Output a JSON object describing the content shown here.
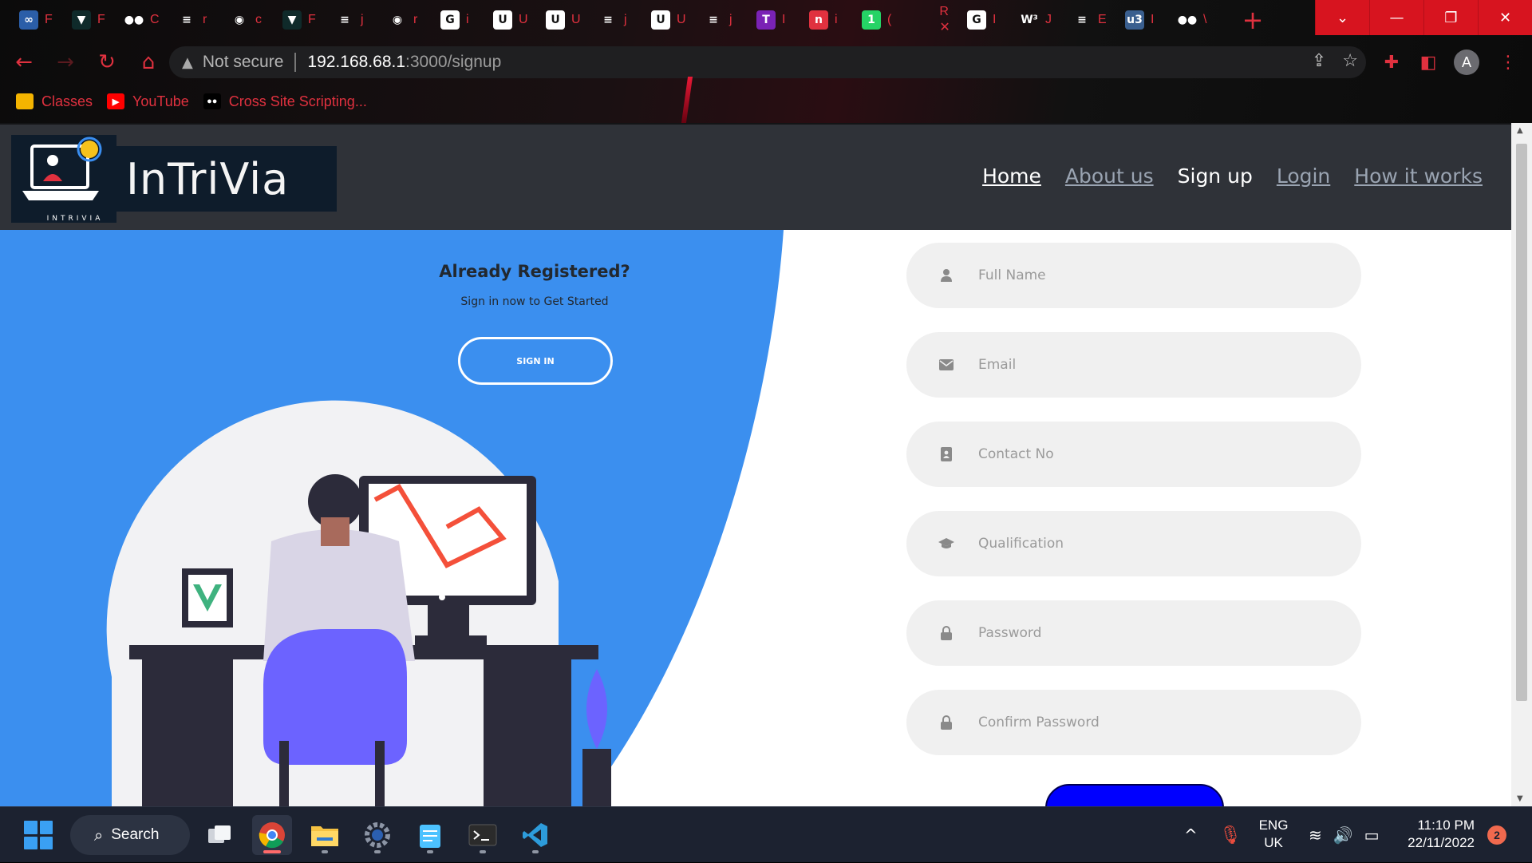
{
  "browser": {
    "tabs": [
      {
        "icon": "infinity-icon",
        "letter": "F",
        "bg": "#2b5ea8",
        "glyph": "∞"
      },
      {
        "icon": "hackthebox-icon",
        "letter": "F",
        "bg": "#0f2a2a",
        "glyph": "▼"
      },
      {
        "icon": "medium-icon",
        "letter": "C",
        "bg": "transparent",
        "glyph": "●●"
      },
      {
        "icon": "stackoverflow-icon",
        "letter": "r",
        "bg": "transparent",
        "glyph": "≡"
      },
      {
        "icon": "github-icon",
        "letter": "c",
        "bg": "transparent",
        "glyph": "◉"
      },
      {
        "icon": "hackthebox-icon",
        "letter": "F",
        "bg": "#0f2a2a",
        "glyph": "▼"
      },
      {
        "icon": "stackoverflow-icon",
        "letter": "j",
        "bg": "transparent",
        "glyph": "≡"
      },
      {
        "icon": "github-icon",
        "letter": "r",
        "bg": "transparent",
        "glyph": "◉"
      },
      {
        "icon": "google-icon",
        "letter": "i",
        "bg": "#ffffff",
        "glyph": "G"
      },
      {
        "icon": "udemy-icon",
        "letter": "U",
        "bg": "#ffffff",
        "glyph": "U"
      },
      {
        "icon": "udemy-icon",
        "letter": "U",
        "bg": "#ffffff",
        "glyph": "U"
      },
      {
        "icon": "stackoverflow-icon",
        "letter": "j",
        "bg": "transparent",
        "glyph": "≡"
      },
      {
        "icon": "udemy-icon",
        "letter": "U",
        "bg": "#ffffff",
        "glyph": "U"
      },
      {
        "icon": "stackoverflow-icon",
        "letter": "j",
        "bg": "transparent",
        "glyph": "≡"
      },
      {
        "icon": "tryhackme-icon",
        "letter": "I",
        "bg": "#7a22b5",
        "glyph": "T"
      },
      {
        "icon": "notion-icon",
        "letter": "i",
        "bg": "#e0313f",
        "glyph": "n"
      },
      {
        "icon": "whatsapp-icon",
        "letter": "(",
        "bg": "#25d366",
        "glyph": "1"
      },
      {
        "icon": "r-tab-icon",
        "letter": "R ✕",
        "bg": "transparent",
        "glyph": ""
      },
      {
        "icon": "google-icon",
        "letter": "I",
        "bg": "#ffffff",
        "glyph": "G"
      },
      {
        "icon": "w3schools-icon",
        "letter": "J",
        "bg": "transparent",
        "glyph": "W³"
      },
      {
        "icon": "stackoverflow-icon",
        "letter": "E",
        "bg": "transparent",
        "glyph": "≡"
      },
      {
        "icon": "w3-icon",
        "letter": "I",
        "bg": "#3a5f8f",
        "glyph": "u3"
      },
      {
        "icon": "medium-icon",
        "letter": "\\",
        "bg": "transparent",
        "glyph": "●●"
      }
    ],
    "new_tab": "+",
    "address": {
      "security": "Not secure",
      "host": "192.168.68.1",
      "path": ":3000/signup"
    },
    "profile_initial": "A",
    "bookmarks": [
      {
        "label": "Classes",
        "icon": "classroom-icon",
        "color": "#f4b400"
      },
      {
        "label": "YouTube",
        "icon": "youtube-icon",
        "color": "#ff0000"
      },
      {
        "label": "Cross Site Scripting...",
        "icon": "medium-icon",
        "color": "#000000"
      }
    ]
  },
  "site": {
    "logo_text": "InTriVia",
    "logo_caption": "INTRIVIA",
    "nav": [
      {
        "label": "Home"
      },
      {
        "label": "About us"
      },
      {
        "label": "Sign up"
      },
      {
        "label": "Login"
      },
      {
        "label": "How it works"
      }
    ]
  },
  "hero": {
    "title": "Already Registered?",
    "subtitle": "Sign in now to Get Started",
    "signin_label": "SIGN IN"
  },
  "form": {
    "fields": [
      {
        "icon": "user-icon",
        "placeholder": "Full Name"
      },
      {
        "icon": "envelope-icon",
        "placeholder": "Email"
      },
      {
        "icon": "contact-card-icon",
        "placeholder": "Contact No"
      },
      {
        "icon": "graduation-cap-icon",
        "placeholder": "Qualification"
      },
      {
        "icon": "lock-icon",
        "placeholder": "Password"
      },
      {
        "icon": "lock-icon",
        "placeholder": "Confirm Password"
      }
    ]
  },
  "taskbar": {
    "search_label": "Search",
    "language": [
      "ENG",
      "UK"
    ],
    "time": "11:10 PM",
    "date": "22/11/2022",
    "notifications": "2"
  },
  "colors": {
    "accent_blue": "#3b8fef",
    "header_dark": "#2f3238",
    "browser_red": "#e0313f",
    "submit_blue": "#0000ff"
  }
}
